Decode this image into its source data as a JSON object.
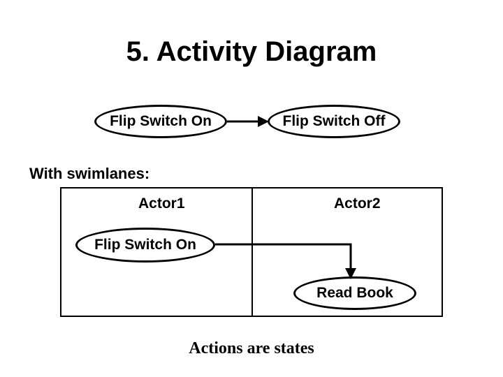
{
  "title": "5. Activity Diagram",
  "top_activities": {
    "left": "Flip Switch On",
    "right": "Flip Switch Off"
  },
  "subheading": "With swimlanes:",
  "swim": {
    "lane1": {
      "header": "Actor1",
      "activity": "Flip Switch On"
    },
    "lane2": {
      "header": "Actor2",
      "activity": "Read Book"
    }
  },
  "footnote": "Actions are states"
}
